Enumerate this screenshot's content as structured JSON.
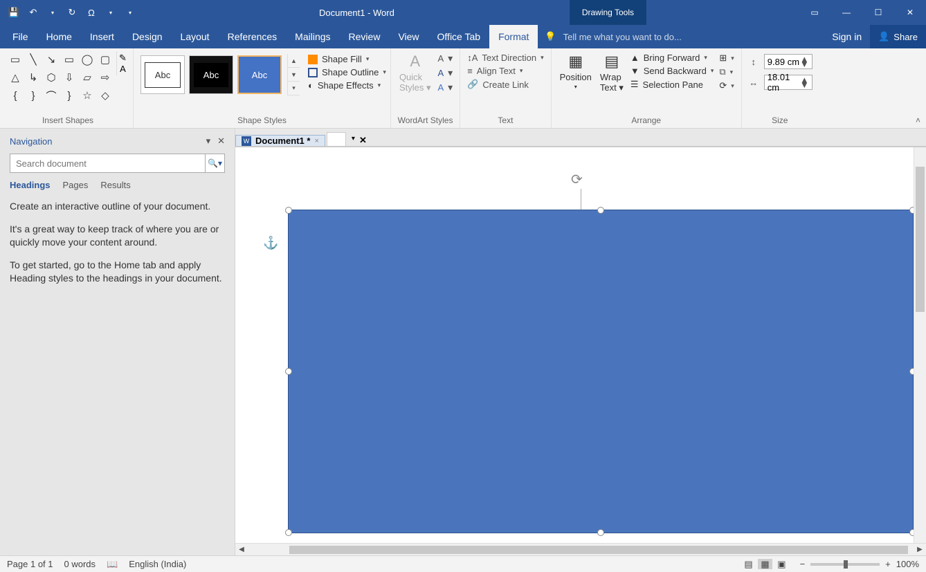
{
  "titlebar": {
    "doc_title": "Document1 - Word",
    "tool_tab": "Drawing Tools"
  },
  "ribbon_tabs": {
    "file": "File",
    "home": "Home",
    "insert": "Insert",
    "design": "Design",
    "layout": "Layout",
    "references": "References",
    "mailings": "Mailings",
    "review": "Review",
    "view": "View",
    "office_tab": "Office Tab",
    "format": "Format"
  },
  "tellme_placeholder": "Tell me what you want to do...",
  "signin": "Sign in",
  "share": "Share",
  "groups": {
    "insert_shapes": "Insert Shapes",
    "shape_styles": "Shape Styles",
    "wordart_styles": "WordArt Styles",
    "text": "Text",
    "arrange": "Arrange",
    "size": "Size"
  },
  "shape_styles": {
    "thumb_label": "Abc",
    "fill": "Shape Fill",
    "outline": "Shape Outline",
    "effects": "Shape Effects"
  },
  "wordart": {
    "quick_styles": "Quick Styles"
  },
  "text": {
    "direction": "Text Direction",
    "align": "Align Text",
    "link": "Create Link"
  },
  "arrange": {
    "position": "Position",
    "wrap": "Wrap Text",
    "forward": "Bring Forward",
    "backward": "Send Backward",
    "selection": "Selection Pane"
  },
  "size": {
    "height": "9.89 cm",
    "width": "18.01 cm"
  },
  "doctab": {
    "name": "Document1 *"
  },
  "nav": {
    "title": "Navigation",
    "search_placeholder": "Search document",
    "tabs": {
      "headings": "Headings",
      "pages": "Pages",
      "results": "Results"
    },
    "p1": "Create an interactive outline of your document.",
    "p2": "It's a great way to keep track of where you are or quickly move your content around.",
    "p3": "To get started, go to the Home tab and apply Heading styles to the headings in your document."
  },
  "status": {
    "page": "Page 1 of 1",
    "words": "0 words",
    "lang": "English (India)",
    "zoom": "100%"
  }
}
